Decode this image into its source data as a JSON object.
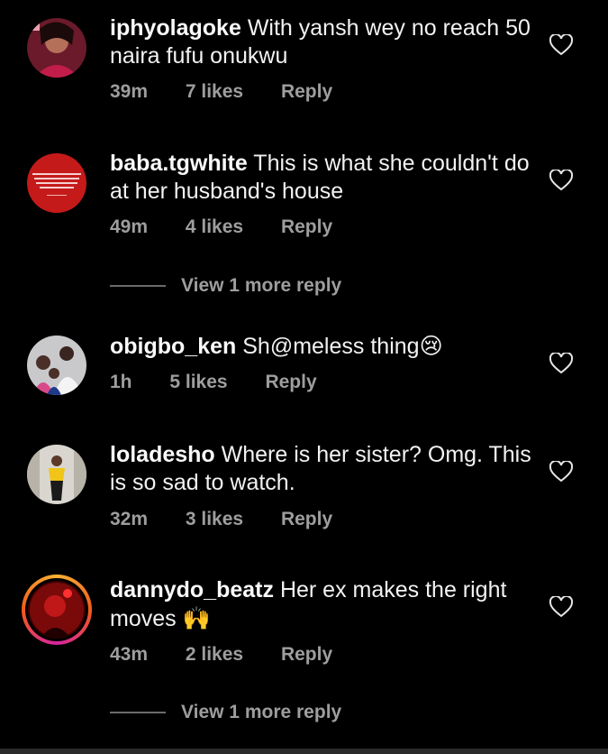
{
  "comments": [
    {
      "username": "iphyolagoke",
      "text": "With yansh wey no reach 50 naira fufu onukwu",
      "time": "39m",
      "likes": "7 likes",
      "reply": "Reply"
    },
    {
      "username": "baba.tgwhite",
      "text": "This is what she couldn't do at her husband's house",
      "time": "49m",
      "likes": "4 likes",
      "reply": "Reply",
      "view_more": "View 1 more reply",
      "avatar_text": "I am not African because I was born in Africa but because Africa was born in me"
    },
    {
      "username": "obigbo_ken",
      "text": "Sh@meless thing",
      "emoji": "😢",
      "time": "1h",
      "likes": "5 likes",
      "reply": "Reply"
    },
    {
      "username": "loladesho",
      "text": "Where is her sister? Omg. This is so sad to watch.",
      "time": "32m",
      "likes": "3 likes",
      "reply": "Reply"
    },
    {
      "username": "dannydo_beatz",
      "text": "Her ex makes the right moves",
      "emoji": "🙌",
      "time": "43m",
      "likes": "2 likes",
      "reply": "Reply",
      "view_more": "View 1 more reply"
    }
  ],
  "colors": {
    "background": "#000000",
    "text": "#f2f2f2",
    "meta": "#9e9e9e",
    "story_ring": "#f25c1a"
  },
  "icons": {
    "like": "heart-outline-icon"
  }
}
